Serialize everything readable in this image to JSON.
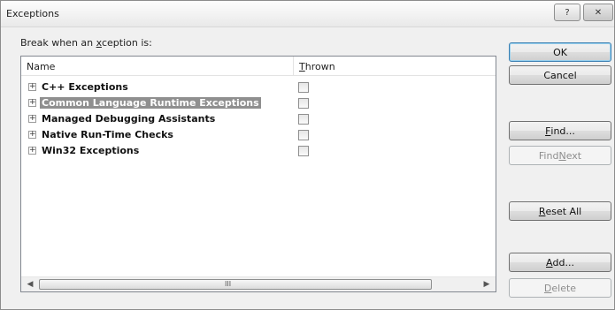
{
  "window": {
    "title": "Exceptions"
  },
  "titlebar": {
    "help_label": "?",
    "close_label": "✕"
  },
  "prompt": {
    "pre": "Break when an ",
    "accel": "x",
    "post": "ception is:"
  },
  "list": {
    "columns": {
      "name": "Name",
      "thrown_accel": "T",
      "thrown_rest": "hrown"
    },
    "rows": [
      {
        "label": "C++ Exceptions",
        "selected": false,
        "thrown": false
      },
      {
        "label": "Common Language Runtime Exceptions",
        "selected": true,
        "thrown": false
      },
      {
        "label": "Managed Debugging Assistants",
        "selected": false,
        "thrown": false
      },
      {
        "label": "Native Run-Time Checks",
        "selected": false,
        "thrown": false
      },
      {
        "label": "Win32 Exceptions",
        "selected": false,
        "thrown": false
      }
    ],
    "expander_glyph": "+",
    "scroll": {
      "left_arrow": "◀",
      "right_arrow": "▶",
      "grip": "III"
    }
  },
  "buttons": {
    "ok": "OK",
    "cancel": "Cancel",
    "find_accel": "F",
    "find_rest": "ind...",
    "findnext_pre": "Find ",
    "findnext_accel": "N",
    "findnext_rest": "ext",
    "resetall_accel": "R",
    "resetall_rest": "eset All",
    "add_accel": "A",
    "add_rest": "dd...",
    "delete_accel": "D",
    "delete_rest": "elete"
  }
}
